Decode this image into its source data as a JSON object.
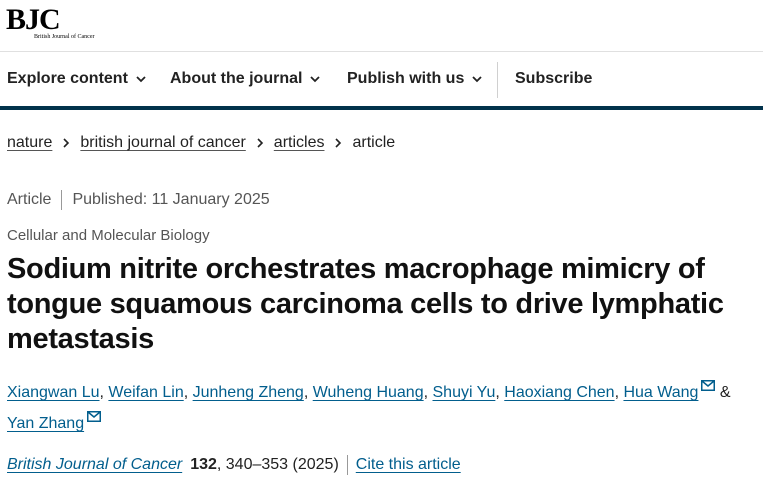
{
  "brand": {
    "logo_text": "BJC",
    "logo_subtitle": "British Journal of Cancer"
  },
  "nav": {
    "items": [
      {
        "label": "Explore content"
      },
      {
        "label": "About the journal"
      },
      {
        "label": "Publish with us"
      }
    ],
    "subscribe_label": "Subscribe"
  },
  "breadcrumb": {
    "items": [
      "nature",
      "british journal of cancer",
      "articles"
    ],
    "current": "article"
  },
  "article": {
    "type": "Article",
    "published": "Published: 11 January 2025",
    "subject": "Cellular and Molecular Biology",
    "title": "Sodium nitrite orchestrates macrophage mimicry of tongue squamous carcinoma cells to drive lymphatic metastasis",
    "authors": [
      "Xiangwan Lu",
      "Weifan Lin",
      "Junheng Zheng",
      "Wuheng Huang",
      "Shuyi Yu",
      "Haoxiang Chen",
      "Hua Wang",
      "Yan Zhang"
    ],
    "author_joiner": "&",
    "citation": {
      "journal": "British Journal of Cancer",
      "volume": "132",
      "rest": ", 340–353 (2025)",
      "cite_label": "Cite this article"
    }
  },
  "icons": {
    "nav_chevron": "chevron-down-icon",
    "breadcrumb_separator": "chevron-right-icon",
    "author_contact": "mail-icon"
  },
  "colors": {
    "link": "#025e8d",
    "nav_rule": "#01324b",
    "text": "#222222"
  }
}
